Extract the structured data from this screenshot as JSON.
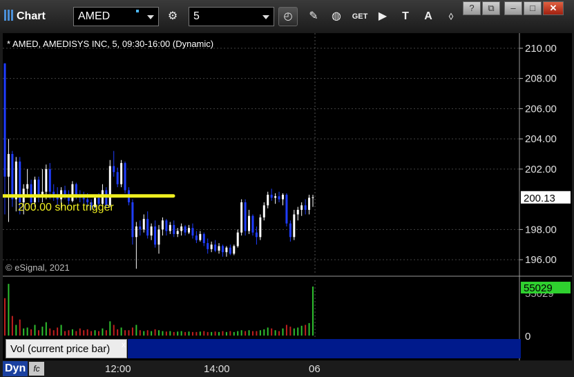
{
  "toolbar": {
    "title": "Chart",
    "symbol": "AMED",
    "interval": "5",
    "icons": [
      "gear-icon",
      "clock-icon",
      "pencil-icon",
      "study-icon",
      "get-icon",
      "play-icon",
      "text-icon",
      "alert-icon",
      "link-icon"
    ],
    "get_label": "GET",
    "text_label": "T",
    "alert_label": "A"
  },
  "window": {
    "help": "?",
    "restore": "⧉",
    "minimize": "–",
    "maximize": "□",
    "close": "✕"
  },
  "chart": {
    "title": "* AMED, AMEDISYS INC, 5, 09:30-16:00 (Dynamic)",
    "copyright": "© eSignal, 2021",
    "annotation": "200.00 short trigger",
    "last_price": "200.13",
    "volume_label": "Vol (current price bar)",
    "volume_close": "x",
    "volume_last": "55029",
    "volume_axis_top": "55029",
    "volume_axis_zero": "0",
    "dyn_label": "Dyn",
    "fc_label": "fc",
    "x_ticks": [
      "12:00",
      "14:00",
      "06"
    ]
  },
  "colors": {
    "up": "#ffffff",
    "down": "#1f3dff",
    "vol_up": "#2fbf2f",
    "vol_down": "#c21f1f",
    "trigger_line": "#f0f020",
    "price_tag_bg": "#ffffff",
    "volume_tag_bg": "#2fd12f"
  },
  "chart_data": {
    "type": "candlestick",
    "title": "* AMED, AMEDISYS INC, 5, 09:30-16:00 (Dynamic)",
    "y_ticks": [
      210.0,
      208.0,
      206.0,
      204.0,
      202.0,
      198.0,
      196.0
    ],
    "ylim": [
      195.0,
      211.0
    ],
    "x_ticks": [
      "12:00",
      "14:00",
      "06"
    ],
    "horizontal_line": {
      "value": 200.13,
      "label": "200.00 short trigger"
    },
    "candles": [
      [
        209.0,
        209.0,
        199.0,
        201.5
      ],
      [
        201.5,
        204.0,
        198.5,
        203.0
      ],
      [
        203.0,
        203.2,
        199.5,
        200.0
      ],
      [
        200.0,
        202.8,
        199.2,
        202.5
      ],
      [
        202.5,
        202.8,
        199.0,
        199.8
      ],
      [
        199.8,
        201.0,
        199.0,
        200.7
      ],
      [
        200.7,
        202.0,
        200.2,
        201.0
      ],
      [
        201.0,
        201.3,
        199.5,
        199.8
      ],
      [
        199.8,
        201.5,
        199.5,
        201.3
      ],
      [
        201.3,
        201.5,
        199.8,
        200.2
      ],
      [
        200.2,
        202.0,
        199.8,
        200.5
      ],
      [
        200.5,
        202.3,
        200.0,
        202.0
      ],
      [
        202.0,
        202.4,
        200.0,
        200.5
      ],
      [
        200.5,
        201.0,
        199.9,
        200.2
      ],
      [
        200.2,
        200.8,
        199.6,
        200.0
      ],
      [
        200.0,
        200.8,
        199.4,
        200.6
      ],
      [
        200.6,
        200.9,
        200.0,
        200.3
      ],
      [
        200.3,
        200.6,
        199.6,
        199.9
      ],
      [
        199.9,
        201.2,
        199.8,
        201.0
      ],
      [
        201.0,
        201.1,
        200.0,
        200.2
      ],
      [
        200.2,
        200.6,
        199.8,
        200.1
      ],
      [
        200.1,
        200.5,
        199.6,
        200.0
      ],
      [
        200.0,
        200.4,
        199.5,
        199.8
      ],
      [
        199.8,
        200.0,
        199.3,
        199.5
      ],
      [
        199.5,
        200.3,
        199.4,
        200.1
      ],
      [
        200.1,
        200.4,
        199.5,
        199.7
      ],
      [
        199.7,
        201.0,
        199.5,
        200.6
      ],
      [
        200.6,
        200.8,
        199.4,
        199.6
      ],
      [
        199.6,
        202.6,
        199.5,
        202.2
      ],
      [
        202.2,
        203.2,
        201.5,
        201.8
      ],
      [
        201.8,
        202.1,
        200.8,
        201.0
      ],
      [
        201.0,
        202.6,
        200.8,
        202.4
      ],
      [
        202.4,
        202.5,
        200.4,
        200.6
      ],
      [
        200.6,
        200.8,
        199.6,
        199.8
      ],
      [
        199.8,
        200.0,
        197.0,
        197.5
      ],
      [
        197.5,
        198.5,
        195.4,
        198.2
      ],
      [
        198.2,
        198.6,
        197.6,
        198.0
      ],
      [
        198.0,
        199.0,
        197.8,
        198.7
      ],
      [
        198.7,
        199.2,
        197.4,
        197.6
      ],
      [
        197.6,
        198.4,
        197.3,
        198.2
      ],
      [
        198.2,
        198.6,
        196.8,
        197.0
      ],
      [
        197.0,
        198.3,
        196.4,
        198.0
      ],
      [
        198.0,
        198.8,
        197.6,
        198.6
      ],
      [
        198.6,
        198.7,
        197.6,
        197.9
      ],
      [
        197.9,
        198.5,
        197.7,
        198.3
      ],
      [
        198.3,
        198.6,
        197.5,
        197.7
      ],
      [
        197.7,
        198.1,
        197.5,
        197.9
      ],
      [
        197.9,
        198.4,
        197.6,
        198.2
      ],
      [
        198.2,
        198.3,
        197.6,
        197.8
      ],
      [
        197.8,
        198.3,
        197.7,
        198.1
      ],
      [
        198.1,
        198.4,
        197.4,
        197.6
      ],
      [
        197.6,
        197.9,
        197.1,
        197.3
      ],
      [
        197.3,
        197.9,
        197.2,
        197.7
      ],
      [
        197.7,
        197.8,
        196.9,
        197.1
      ],
      [
        197.1,
        197.4,
        196.4,
        196.7
      ],
      [
        196.7,
        197.2,
        196.5,
        197.0
      ],
      [
        197.0,
        197.3,
        196.5,
        196.6
      ],
      [
        196.6,
        197.1,
        196.4,
        196.9
      ],
      [
        196.9,
        197.0,
        196.2,
        196.5
      ],
      [
        196.5,
        196.9,
        196.2,
        196.8
      ],
      [
        196.8,
        197.0,
        196.3,
        196.4
      ],
      [
        196.4,
        197.0,
        196.3,
        196.9
      ],
      [
        196.9,
        198.0,
        196.8,
        197.8
      ],
      [
        197.8,
        200.0,
        197.6,
        199.8
      ],
      [
        199.8,
        200.0,
        197.6,
        197.9
      ],
      [
        197.9,
        199.3,
        197.7,
        198.9
      ],
      [
        198.9,
        199.0,
        197.6,
        197.8
      ],
      [
        197.8,
        198.2,
        197.0,
        197.5
      ],
      [
        197.5,
        199.0,
        197.3,
        198.8
      ],
      [
        198.8,
        199.8,
        198.6,
        199.6
      ],
      [
        199.6,
        200.5,
        199.4,
        200.3
      ],
      [
        200.3,
        200.7,
        199.9,
        200.1
      ],
      [
        200.1,
        200.4,
        199.7,
        200.2
      ],
      [
        200.2,
        200.5,
        199.8,
        200.0
      ],
      [
        200.0,
        200.4,
        199.6,
        200.3
      ],
      [
        200.3,
        200.4,
        198.2,
        198.4
      ],
      [
        198.4,
        198.6,
        197.2,
        197.5
      ],
      [
        197.5,
        199.3,
        197.3,
        199.0
      ],
      [
        199.0,
        199.5,
        198.6,
        199.3
      ],
      [
        199.3,
        199.8,
        198.9,
        199.6
      ],
      [
        199.6,
        200.0,
        199.0,
        199.3
      ],
      [
        199.3,
        200.3,
        199.0,
        200.1
      ],
      [
        200.1,
        200.3,
        199.5,
        200.13
      ]
    ],
    "volume_ylim": [
      0,
      62000
    ],
    "volume": [
      42000,
      58000,
      22000,
      12000,
      18000,
      8000,
      9000,
      7000,
      12000,
      6000,
      10000,
      15000,
      8000,
      6000,
      9000,
      12000,
      5000,
      6000,
      7000,
      5000,
      8000,
      6000,
      7000,
      5000,
      6000,
      5000,
      8000,
      6000,
      16000,
      12000,
      7000,
      9000,
      6000,
      6000,
      9000,
      12000,
      6000,
      5000,
      6000,
      5000,
      7000,
      6000,
      5000,
      4500,
      5000,
      4000,
      4500,
      5000,
      4000,
      4500,
      4000,
      4000,
      4500,
      5000,
      4000,
      4000,
      4500,
      4000,
      5000,
      4000,
      5000,
      4000,
      5000,
      6000,
      5000,
      6000,
      5000,
      5000,
      6000,
      7000,
      9000,
      8000,
      6000,
      5000,
      8000,
      12000,
      10000,
      8000,
      9000,
      11000,
      12000,
      14000,
      55029
    ]
  }
}
